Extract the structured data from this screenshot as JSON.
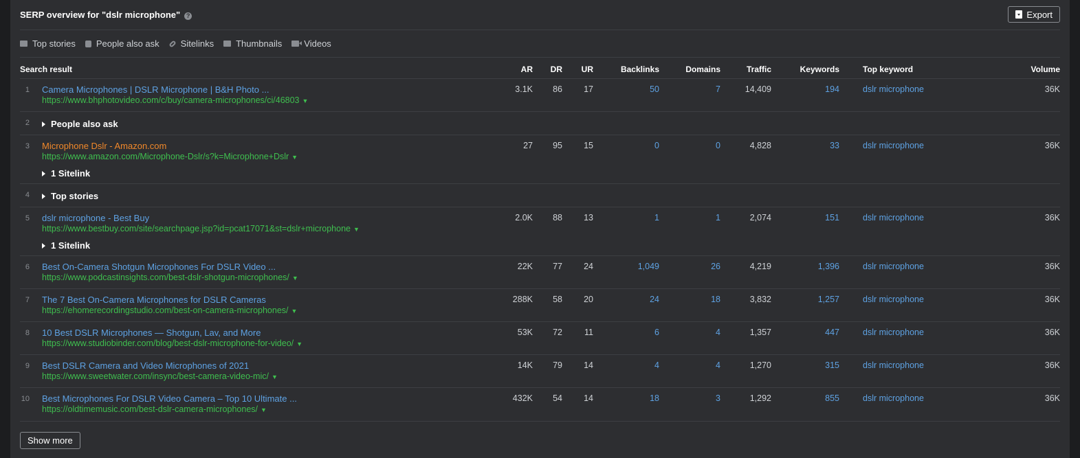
{
  "header": {
    "title": "SERP overview for \"dslr microphone\"",
    "help_glyph": "?",
    "export_label": "Export"
  },
  "features": [
    {
      "icon": "newspaper-icon",
      "label": "Top stories"
    },
    {
      "icon": "question-icon",
      "label": "People also ask"
    },
    {
      "icon": "link-icon",
      "label": "Sitelinks"
    },
    {
      "icon": "image-icon",
      "label": "Thumbnails"
    },
    {
      "icon": "video-icon",
      "label": "Videos"
    }
  ],
  "columns": {
    "search_result": "Search result",
    "ar": "AR",
    "dr": "DR",
    "ur": "UR",
    "backlinks": "Backlinks",
    "domains": "Domains",
    "traffic": "Traffic",
    "keywords": "Keywords",
    "top_keyword": "Top keyword",
    "volume": "Volume"
  },
  "rows": [
    {
      "n": "1",
      "title": "Camera Microphones | DSLR Microphone | B&H Photo ...",
      "url": "https://www.bhphotovideo.com/c/buy/camera-microphones/ci/46803",
      "ar": "3.1K",
      "dr": "86",
      "ur": "17",
      "backlinks": "50",
      "domains": "7",
      "traffic": "14,409",
      "keywords": "194",
      "top_keyword": "dslr microphone",
      "volume": "36K"
    },
    {
      "n": "2",
      "expand": "People also ask"
    },
    {
      "n": "3",
      "title": "Microphone Dslr - Amazon.com",
      "url": "https://www.amazon.com/Microphone-Dslr/s?k=Microphone+Dslr",
      "ar": "27",
      "dr": "95",
      "ur": "15",
      "backlinks": "0",
      "domains": "0",
      "traffic": "4,828",
      "keywords": "33",
      "top_keyword": "dslr microphone",
      "volume": "36K",
      "sitelink": "1 Sitelink"
    },
    {
      "n": "4",
      "expand": "Top stories"
    },
    {
      "n": "5",
      "title": "dslr microphone - Best Buy",
      "url": "https://www.bestbuy.com/site/searchpage.jsp?id=pcat17071&st=dslr+microphone",
      "ar": "2.0K",
      "dr": "88",
      "ur": "13",
      "backlinks": "1",
      "domains": "1",
      "traffic": "2,074",
      "keywords": "151",
      "top_keyword": "dslr microphone",
      "volume": "36K",
      "sitelink": "1 Sitelink"
    },
    {
      "n": "6",
      "title": "Best On-Camera Shotgun Microphones For DSLR Video ...",
      "url": "https://www.podcastinsights.com/best-dslr-shotgun-microphones/",
      "ar": "22K",
      "dr": "77",
      "ur": "24",
      "backlinks": "1,049",
      "domains": "26",
      "traffic": "4,219",
      "keywords": "1,396",
      "top_keyword": "dslr microphone",
      "volume": "36K"
    },
    {
      "n": "7",
      "title": "The 7 Best On-Camera Microphones for DSLR Cameras",
      "url": "https://ehomerecordingstudio.com/best-on-camera-microphones/",
      "ar": "288K",
      "dr": "58",
      "ur": "20",
      "backlinks": "24",
      "domains": "18",
      "traffic": "3,832",
      "keywords": "1,257",
      "top_keyword": "dslr microphone",
      "volume": "36K"
    },
    {
      "n": "8",
      "title": "10 Best DSLR Microphones — Shotgun, Lav, and More",
      "url": "https://www.studiobinder.com/blog/best-dslr-microphone-for-video/",
      "ar": "53K",
      "dr": "72",
      "ur": "11",
      "backlinks": "6",
      "domains": "4",
      "traffic": "1,357",
      "keywords": "447",
      "top_keyword": "dslr microphone",
      "volume": "36K"
    },
    {
      "n": "9",
      "title": "Best DSLR Camera and Video Microphones of 2021",
      "url": "https://www.sweetwater.com/insync/best-camera-video-mic/",
      "ar": "14K",
      "dr": "79",
      "ur": "14",
      "backlinks": "4",
      "domains": "4",
      "traffic": "1,270",
      "keywords": "315",
      "top_keyword": "dslr microphone",
      "volume": "36K"
    },
    {
      "n": "10",
      "title": "Best Microphones For DSLR Video Camera – Top 10 Ultimate ...",
      "url": "https://oldtimemusic.com/best-dslr-camera-microphones/",
      "ar": "432K",
      "dr": "54",
      "ur": "14",
      "backlinks": "18",
      "domains": "3",
      "traffic": "1,292",
      "keywords": "855",
      "top_keyword": "dslr microphone",
      "volume": "36K"
    }
  ],
  "footer": {
    "show_more_label": "Show more"
  }
}
